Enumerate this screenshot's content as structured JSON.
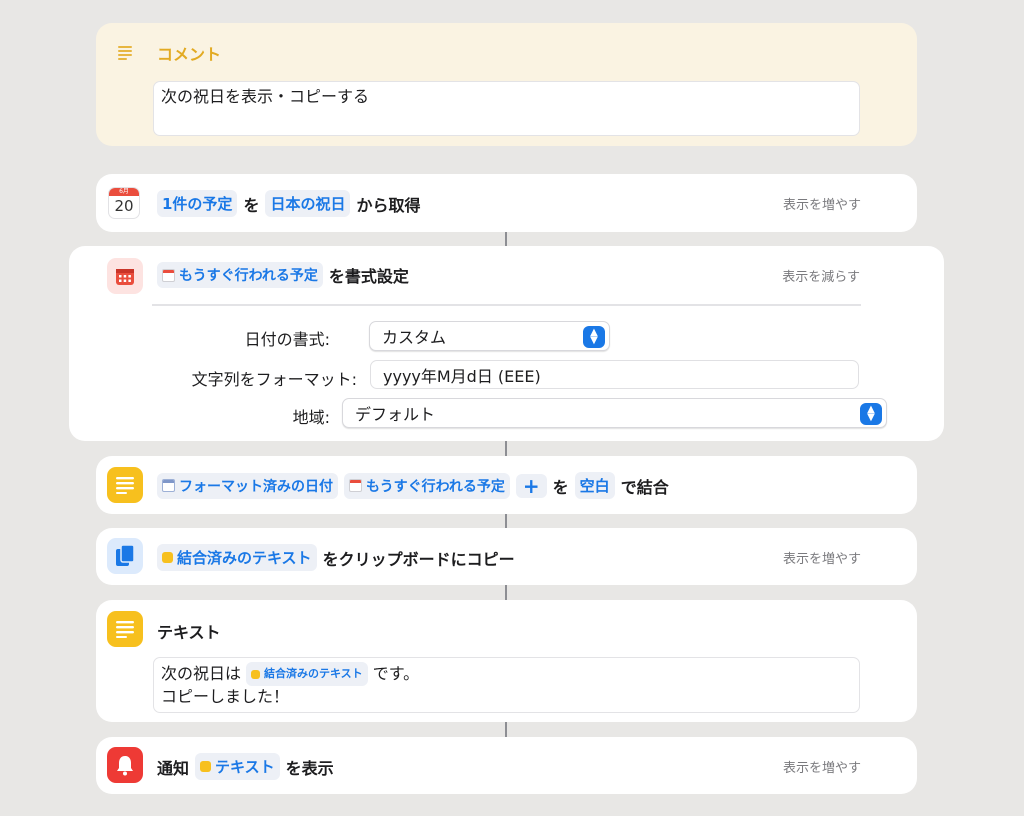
{
  "comment": {
    "title": "コメント",
    "body": "次の祝日を表示・コピーする"
  },
  "get_events": {
    "icon_month": "6月",
    "icon_day": "20",
    "count_token": "1件の予定",
    "joiner": "を",
    "calendar_token": "日本の祝日",
    "suffix": "から取得",
    "more": "表示を増やす"
  },
  "format_date": {
    "input_token": "もうすぐ行われる予定",
    "suffix": "を書式設定",
    "less": "表示を減らす",
    "date_format_label": "日付の書式:",
    "date_format_value": "カスタム",
    "format_string_label": "文字列をフォーマット:",
    "format_string_value": "yyyy年M月d日 (EEE)",
    "locale_label": "地域:",
    "locale_value": "デフォルト"
  },
  "combine": {
    "token1": "フォーマット済みの日付",
    "token2": "もうすぐ行われる予定",
    "plus": "+",
    "joiner": "を",
    "separator_token": "空白",
    "suffix": "で結合"
  },
  "copy": {
    "token": "結合済みのテキスト",
    "suffix": "をクリップボードにコピー",
    "more": "表示を増やす"
  },
  "text_action": {
    "title": "テキスト",
    "line1_prefix": "次の祝日は",
    "line1_token": "結合済みのテキスト",
    "line1_suffix": "です。",
    "line2": "コピーしました！"
  },
  "notify": {
    "prefix": "通知",
    "token": "テキスト",
    "suffix": "を表示",
    "more": "表示を増やす"
  },
  "colors": {
    "accent": "#1a78e6",
    "comment_bg": "#faf3e2",
    "note_yellow": "#f7c01e",
    "notify_red": "#ee3a35",
    "calendar_red": "#ea4d3d"
  }
}
